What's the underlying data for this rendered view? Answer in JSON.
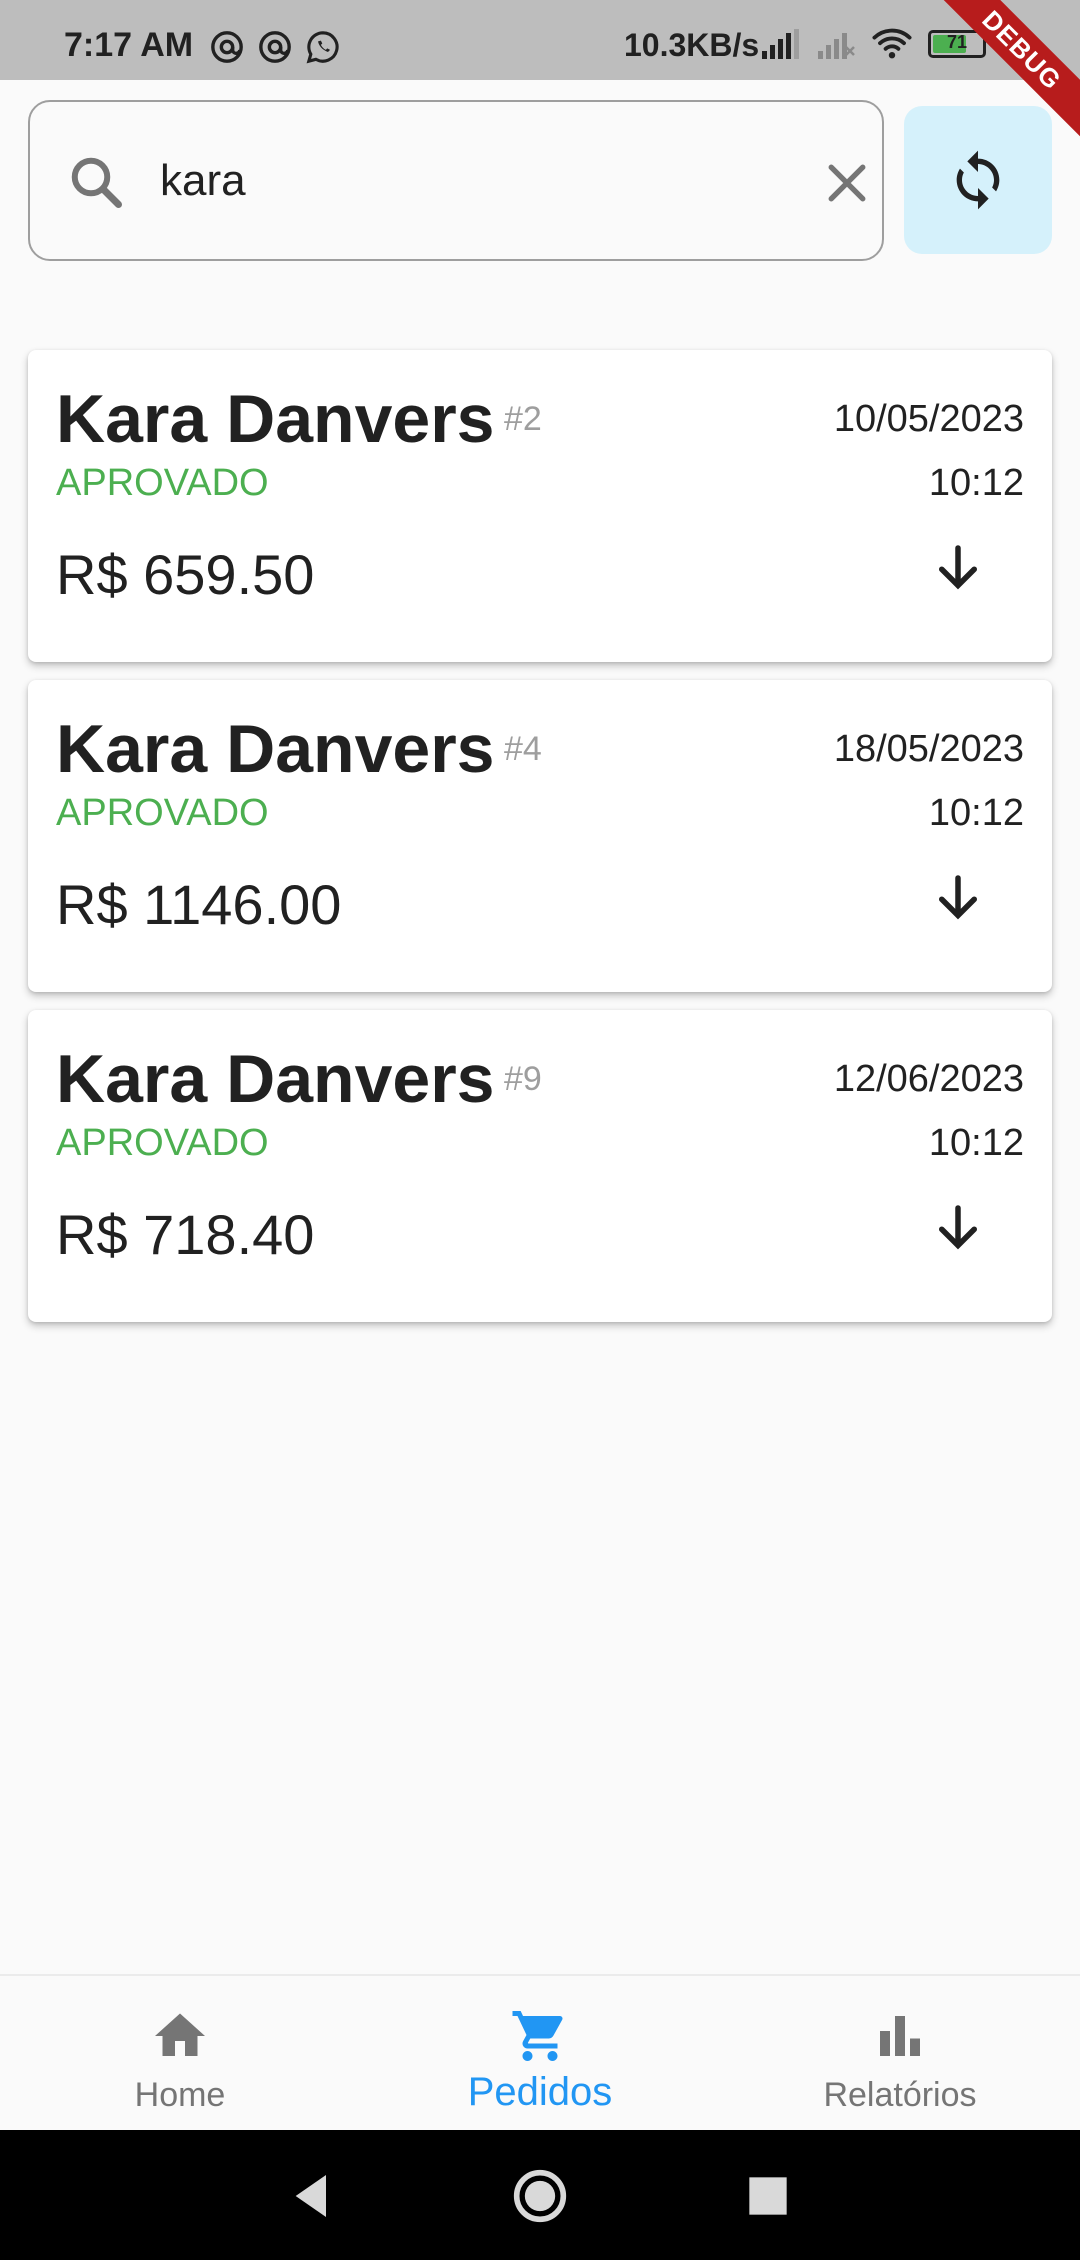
{
  "status_bar": {
    "time": "7:17 AM",
    "net_speed": "10.3KB/s",
    "battery_level": "71",
    "debug_label": "DEBUG",
    "left_icons": [
      "at-sign-icon",
      "at-sign-icon",
      "whatsapp-icon"
    ],
    "right_icons": [
      "signal-icon",
      "signal-off-icon",
      "wifi-icon",
      "battery-icon",
      "charging-bolt-icon"
    ]
  },
  "search": {
    "value": "kara",
    "icon": "search-icon",
    "clear_icon": "close-icon",
    "refresh_icon": "sync-icon"
  },
  "orders": [
    {
      "customer": "Kara Danvers",
      "id": "#2",
      "status": "APROVADO",
      "date": "10/05/2023",
      "time": "10:12",
      "amount": "R$ 659.50"
    },
    {
      "customer": "Kara Danvers",
      "id": "#4",
      "status": "APROVADO",
      "date": "18/05/2023",
      "time": "10:12",
      "amount": "R$ 1146.00"
    },
    {
      "customer": "Kara Danvers",
      "id": "#9",
      "status": "APROVADO",
      "date": "12/06/2023",
      "time": "10:12",
      "amount": "R$ 718.40"
    }
  ],
  "bottom_nav": {
    "items": [
      {
        "label": "Home",
        "icon": "home-icon",
        "active": false
      },
      {
        "label": "Pedidos",
        "icon": "cart-icon",
        "active": true
      },
      {
        "label": "Relatórios",
        "icon": "bar-chart-icon",
        "active": false
      }
    ]
  },
  "colors": {
    "status_approved": "#4caf50",
    "active_nav": "#2196f3",
    "inactive_nav": "#757575",
    "refresh_button_bg": "#d5f1fb",
    "debug_ribbon": "#b71c1c"
  }
}
